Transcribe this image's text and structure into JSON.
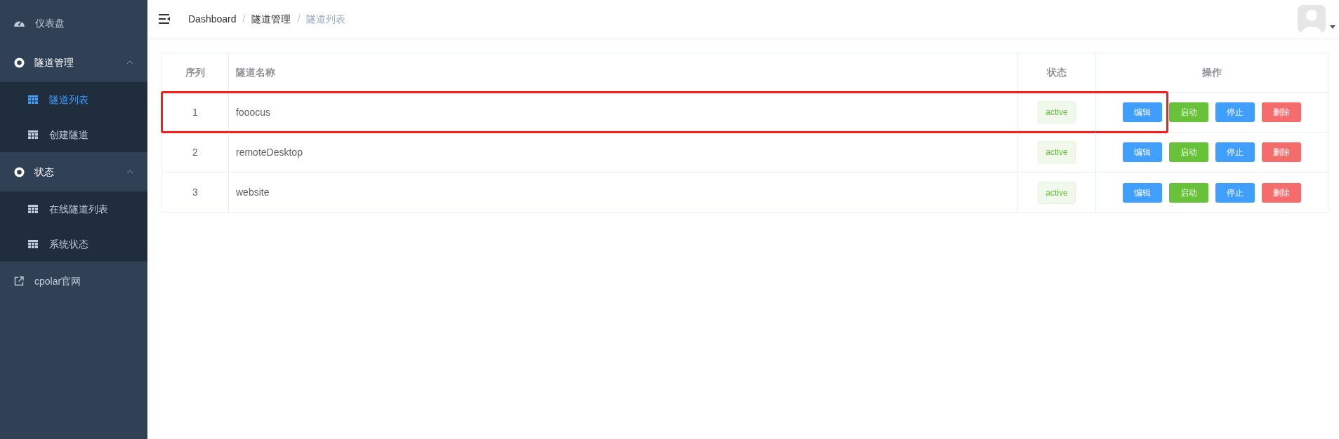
{
  "sidebar": {
    "items": [
      {
        "kind": "link",
        "label": "仪表盘"
      },
      {
        "kind": "group",
        "label": "隧道管理",
        "expanded": true,
        "children": [
          {
            "label": "隧道列表",
            "selected": true
          },
          {
            "label": "创建隧道",
            "selected": false
          }
        ]
      },
      {
        "kind": "group",
        "label": "状态",
        "expanded": true,
        "children": [
          {
            "label": "在线隧道列表",
            "selected": false
          },
          {
            "label": "系统状态",
            "selected": false
          }
        ]
      },
      {
        "kind": "external",
        "label": "cpolar官网"
      }
    ]
  },
  "breadcrumb": [
    {
      "label": "Dashboard"
    },
    {
      "separator": "/",
      "label": "隧道管理"
    },
    {
      "separator": "/",
      "label": "隧道列表"
    }
  ],
  "table": {
    "columns": [
      "序列",
      "隧道名称",
      "状态",
      "操作"
    ],
    "rows": [
      {
        "index": "1",
        "name": "fooocus",
        "status": "active",
        "highlighted": true,
        "actions": [
          {
            "kind": "primary",
            "label": "编辑"
          },
          {
            "kind": "success",
            "label": "启动"
          },
          {
            "kind": "primary",
            "label": "停止"
          },
          {
            "kind": "danger",
            "label": "删除"
          }
        ]
      },
      {
        "index": "2",
        "name": "remoteDesktop",
        "status": "active",
        "highlighted": false,
        "actions": [
          {
            "kind": "primary",
            "label": "编辑"
          },
          {
            "kind": "success",
            "label": "启动"
          },
          {
            "kind": "primary",
            "label": "停止"
          },
          {
            "kind": "danger",
            "label": "删除"
          }
        ]
      },
      {
        "index": "3",
        "name": "website",
        "status": "active",
        "highlighted": false,
        "actions": [
          {
            "kind": "primary",
            "label": "编辑"
          },
          {
            "kind": "success",
            "label": "启动"
          },
          {
            "kind": "primary",
            "label": "停止"
          },
          {
            "kind": "danger",
            "label": "删除"
          }
        ]
      }
    ]
  }
}
